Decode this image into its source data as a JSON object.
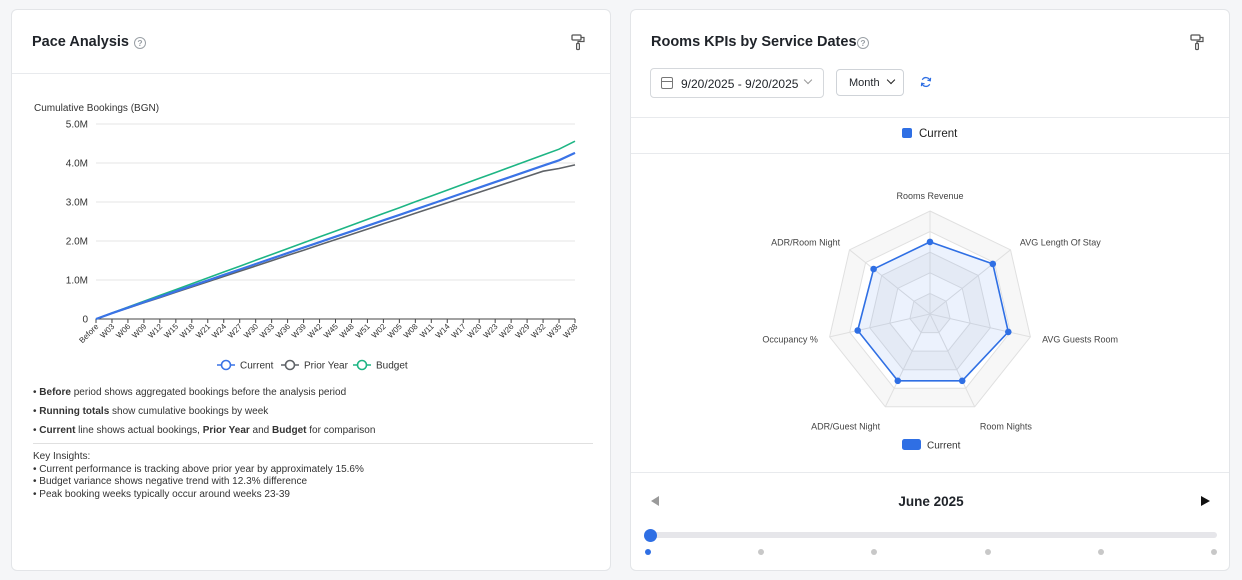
{
  "pace": {
    "title": "Pace Analysis",
    "help": "?",
    "chart_data": {
      "type": "line",
      "title": "",
      "ylabel": "Cumulative Bookings (BGN)",
      "y_ticks": [
        "0",
        "1.0M",
        "2.0M",
        "3.0M",
        "4.0M",
        "5.0M"
      ],
      "ylim": [
        0,
        5000000
      ],
      "grid": true,
      "legend_position": "bottom",
      "categories": [
        "Before",
        "W03",
        "W06",
        "W09",
        "W12",
        "W15",
        "W18",
        "W21",
        "W24",
        "W27",
        "W30",
        "W33",
        "W36",
        "W39",
        "W42",
        "W45",
        "W48",
        "W51",
        "W02",
        "W05",
        "W08",
        "W11",
        "W14",
        "W17",
        "W20",
        "W23",
        "W26",
        "W29",
        "W32",
        "W35",
        "W38"
      ],
      "series": [
        {
          "name": "Current",
          "color": "#3a73e6",
          "values": [
            0,
            150000,
            290000,
            430000,
            570000,
            710000,
            850000,
            990000,
            1130000,
            1270000,
            1410000,
            1550000,
            1690000,
            1830000,
            1970000,
            2110000,
            2250000,
            2390000,
            2530000,
            2670000,
            2810000,
            2950000,
            3090000,
            3230000,
            3370000,
            3510000,
            3650000,
            3790000,
            3930000,
            4070000,
            4260000
          ]
        },
        {
          "name": "Prior Year",
          "color": "#5f6368",
          "values": [
            0,
            145000,
            280000,
            415000,
            550000,
            685000,
            820000,
            955000,
            1090000,
            1225000,
            1360000,
            1495000,
            1630000,
            1765000,
            1900000,
            2035000,
            2170000,
            2305000,
            2440000,
            2575000,
            2710000,
            2845000,
            2980000,
            3115000,
            3250000,
            3385000,
            3520000,
            3655000,
            3790000,
            3860000,
            3950000
          ]
        },
        {
          "name": "Budget",
          "color": "#1db584",
          "values": [
            0,
            155000,
            305000,
            455000,
            605000,
            755000,
            905000,
            1055000,
            1205000,
            1355000,
            1505000,
            1655000,
            1805000,
            1955000,
            2105000,
            2255000,
            2405000,
            2555000,
            2705000,
            2855000,
            3005000,
            3155000,
            3305000,
            3455000,
            3605000,
            3755000,
            3905000,
            4055000,
            4205000,
            4355000,
            4560000
          ]
        }
      ]
    },
    "notes": [
      {
        "b1": "Before",
        "t1": " period shows aggregated bookings before the analysis period",
        "b2": "",
        "t2": "",
        "b3": "",
        "t3": ""
      },
      {
        "b1": "Running totals",
        "t1": " show cumulative bookings by week",
        "b2": "",
        "t2": "",
        "b3": "",
        "t3": ""
      },
      {
        "b1": "Current",
        "t1": " line shows actual bookings, ",
        "b2": "Prior Year",
        "t2": " and ",
        "b3": "Budget",
        "t3": " for comparison"
      }
    ],
    "insights": {
      "heading": "Key Insights:",
      "items": [
        "• Current performance is tracking above prior year by approximately 15.6%",
        "• Budget variance shows negative trend with 12.3% difference",
        "• Peak booking weeks typically occur around weeks 23-39"
      ]
    }
  },
  "kpi": {
    "title": "Rooms KPIs by Service Dates",
    "help": "?",
    "date_range": "9/20/2025 - 9/20/2025",
    "period_select": "Month",
    "legend_top": "Current",
    "chart_data": {
      "type": "radar",
      "axes": [
        "Rooms Revenue",
        "AVG Length Of Stay",
        "AVG Guests Room",
        "Room Nights",
        "ADR/Guest Night",
        "Occupancy %",
        "ADR/Room Night"
      ],
      "series": [
        {
          "name": "Current",
          "color": "#2f6fe4",
          "values": [
            0.7,
            0.78,
            0.78,
            0.72,
            0.72,
            0.72,
            0.7
          ]
        }
      ],
      "legend_position": "bottom"
    },
    "timeline": {
      "month_label": "June 2025",
      "position": 0.0,
      "dots": 6,
      "active_dot": 0
    }
  }
}
